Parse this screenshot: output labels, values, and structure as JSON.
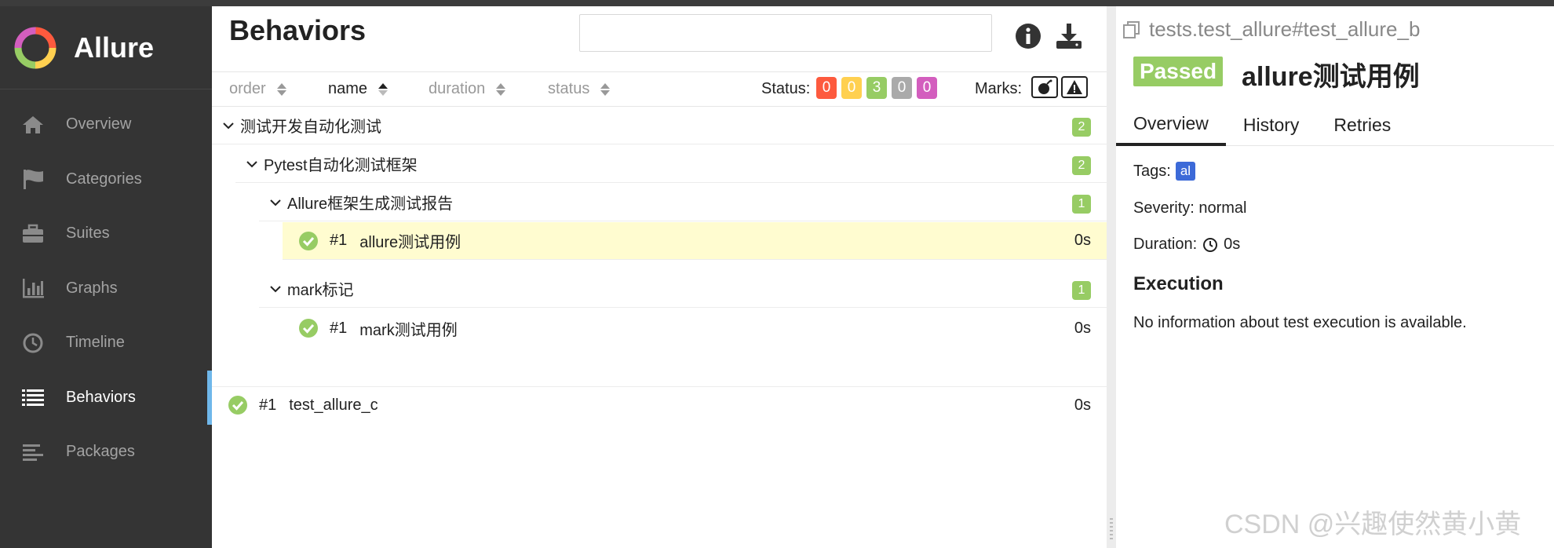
{
  "colors": {
    "sidebar_bg": "#343434",
    "active_accent": "#6fb7ea",
    "passed": "#97cc64",
    "failed": "#fd5a3e",
    "broken": "#ffd050",
    "skipped": "#aaaaaa",
    "unknown": "#d35ebe",
    "tag": "#3c6ad8",
    "selected_row": "#fffcd0"
  },
  "app": {
    "name": "Allure"
  },
  "sidebar": {
    "items": [
      {
        "label": "Overview",
        "icon": "home-icon"
      },
      {
        "label": "Categories",
        "icon": "flag-icon"
      },
      {
        "label": "Suites",
        "icon": "briefcase-icon"
      },
      {
        "label": "Graphs",
        "icon": "bar-chart-icon"
      },
      {
        "label": "Timeline",
        "icon": "clock-icon"
      },
      {
        "label": "Behaviors",
        "icon": "list-icon",
        "active": true
      },
      {
        "label": "Packages",
        "icon": "align-left-icon"
      }
    ]
  },
  "main": {
    "title": "Behaviors",
    "search": {
      "value": "",
      "placeholder": ""
    },
    "sort": {
      "order": "order",
      "name": "name",
      "duration": "duration",
      "status": "status"
    },
    "status_label": "Status:",
    "status_counts": [
      "0",
      "0",
      "3",
      "0",
      "0"
    ],
    "marks_label": "Marks:",
    "tree": {
      "epic": {
        "label": "测试开发自动化测试",
        "count": "2"
      },
      "feature": {
        "label": "Pytest自动化测试框架",
        "count": "2"
      },
      "story1": {
        "label": "Allure框架生成测试报告",
        "count": "1"
      },
      "test1": {
        "num": "#1",
        "label": "allure测试用例",
        "duration": "0s"
      },
      "story2": {
        "label": "mark标记",
        "count": "1"
      },
      "test2": {
        "num": "#1",
        "label": "mark测试用例",
        "duration": "0s"
      },
      "test3": {
        "num": "#1",
        "label": "test_allure_c",
        "duration": "0s"
      }
    }
  },
  "detail": {
    "breadcrumb": "tests.test_allure#test_allure_b",
    "status": "Passed",
    "title": "allure测试用例",
    "tabs": [
      "Overview",
      "History",
      "Retries"
    ],
    "tags_label": "Tags:",
    "tag": "al",
    "severity": "Severity: normal",
    "duration_label": "Duration:",
    "duration_value": "0s",
    "execution_title": "Execution",
    "execution_text": "No information about test execution is available."
  },
  "watermark": "CSDN @兴趣使然黄小黄"
}
